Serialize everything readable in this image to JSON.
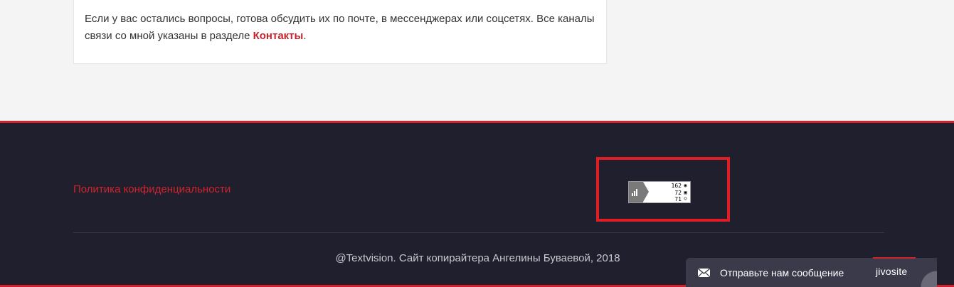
{
  "content": {
    "text_before_link": "Если у вас остались вопросы, готова обсудить их по почте, в мессенджерах или соцсетях. Все каналы связи со мной указаны в разделе ",
    "contacts_link": "Контакты",
    "text_after_link": "."
  },
  "footer": {
    "privacy_link": "Политика конфиденциальности",
    "counter": {
      "views": "162",
      "visits": "72",
      "visitors": "71"
    },
    "copyright": "@Textvision. Сайт копирайтера Ангелины Буваевой, 2018"
  },
  "chat": {
    "label": "Отправьте нам сообщение",
    "brand": "jivosite"
  },
  "colors": {
    "accent": "#d1232c",
    "footer_bg": "#201f2e",
    "highlight": "#e11d24"
  },
  "icons": {
    "counter": "bar-chart-icon",
    "views": "eye-icon",
    "visits": "session-icon",
    "visitors": "person-icon",
    "chat": "mail-icon"
  }
}
